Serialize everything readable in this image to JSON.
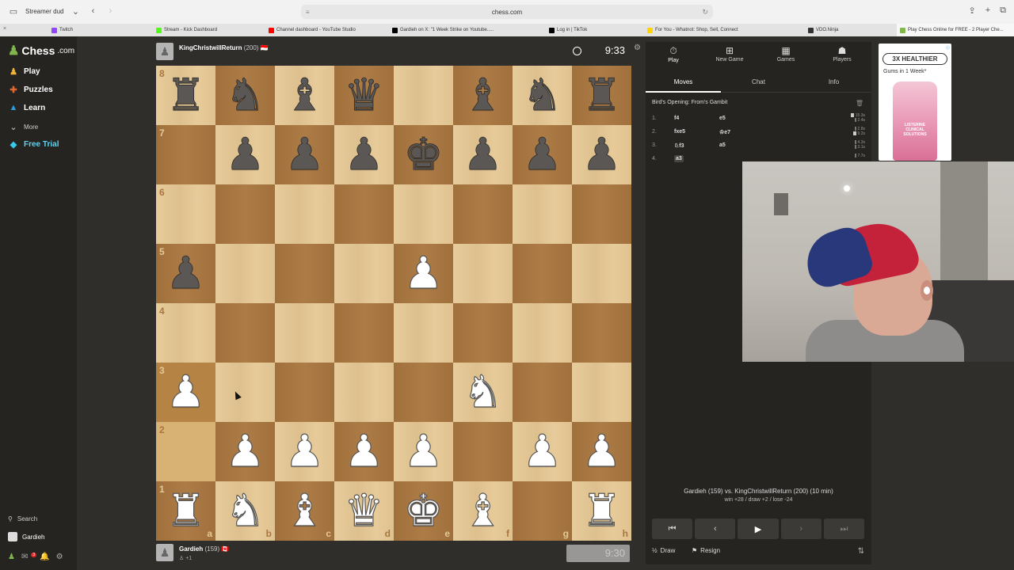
{
  "browser": {
    "profile": "Streamer dud",
    "url": "chess.com",
    "tabs": [
      {
        "label": "Twitch",
        "color": "#9146ff"
      },
      {
        "label": "Stream - Kick Dashboard",
        "color": "#53fc18"
      },
      {
        "label": "Channel dashboard - YouTube Studio",
        "color": "#ff0000"
      },
      {
        "label": "Gardieh on X: \"1 Week Strike on Youtube.....",
        "color": "#000000"
      },
      {
        "label": "Log in | TikTok",
        "color": "#000000"
      },
      {
        "label": "For You - Whatnot: Shop, Sell, Connect",
        "color": "#ffd400"
      },
      {
        "label": "VDO.Ninja",
        "color": "#333333"
      },
      {
        "label": "Play Chess Online for FREE - 2 Player Che...",
        "color": "#81b64c"
      }
    ]
  },
  "sidebar": {
    "logo": "Chess",
    "logo_suffix": ".com",
    "items": [
      {
        "label": "Play",
        "icon": "play-icon",
        "glyph": "♟",
        "color": "#f0b33a"
      },
      {
        "label": "Puzzles",
        "icon": "puzzle-icon",
        "glyph": "✚",
        "color": "#e2672f"
      },
      {
        "label": "Learn",
        "icon": "learn-icon",
        "glyph": "▲",
        "color": "#2c9ce0"
      },
      {
        "label": "More",
        "icon": "chevron-down-icon",
        "glyph": "⌄",
        "color": "#cccccc"
      },
      {
        "label": "Free Trial",
        "icon": "diamond-icon",
        "glyph": "◆",
        "color": "#38c8e8"
      }
    ],
    "search_label": "Search",
    "user_label": "Gardieh",
    "notification_count": "3"
  },
  "game": {
    "top_player": {
      "name": "KingChristwillReturn",
      "rating": "(200)",
      "flag": "🇮🇩",
      "clock": "9:33"
    },
    "bottom_player": {
      "name": "Gardieh",
      "rating": "(159)",
      "flag": "🇨🇦",
      "captured": "♙ +1",
      "clock": "9:30"
    },
    "board": [
      [
        "bR",
        "bN",
        "bB",
        "bQ",
        "",
        "bB",
        "bN",
        "bR"
      ],
      [
        "",
        "bP",
        "bP",
        "bP",
        "bK",
        "bP",
        "bP",
        "bP"
      ],
      [
        "",
        "",
        "",
        "",
        "",
        "",
        "",
        ""
      ],
      [
        "bP",
        "",
        "",
        "",
        "wP",
        "",
        "",
        ""
      ],
      [
        "",
        "",
        "",
        "",
        "",
        "",
        "",
        ""
      ],
      [
        "wP",
        "",
        "",
        "",
        "",
        "wN",
        "",
        ""
      ],
      [
        "",
        "wP",
        "wP",
        "wP",
        "wP",
        "",
        "wP",
        "wP"
      ],
      [
        "wR",
        "wN",
        "wB",
        "wQ",
        "wK",
        "wB",
        "",
        "wR"
      ]
    ],
    "ranks": [
      "8",
      "7",
      "6",
      "5",
      "4",
      "3",
      "2",
      "1"
    ],
    "files": [
      "a",
      "b",
      "c",
      "d",
      "e",
      "f",
      "g",
      "h"
    ]
  },
  "panel": {
    "nav": [
      {
        "label": "Play",
        "icon": "stopwatch-icon",
        "glyph": "⏱"
      },
      {
        "label": "New Game",
        "icon": "plus-square-icon",
        "glyph": "⊞"
      },
      {
        "label": "Games",
        "icon": "grid-icon",
        "glyph": "▦"
      },
      {
        "label": "Players",
        "icon": "players-icon",
        "glyph": "👥"
      }
    ],
    "tabs": [
      "Moves",
      "Chat",
      "Info"
    ],
    "opening": "Bird's Opening: From's Gambit",
    "moves": [
      {
        "num": "1.",
        "white": "f4",
        "black": "e5",
        "time_w": "15.3s",
        "time_b": "2.4s"
      },
      {
        "num": "2.",
        "white": "fxe5",
        "black": "♔e7",
        "time_w": "2.8s",
        "time_b": "9.2s"
      },
      {
        "num": "3.",
        "white": "♘f3",
        "black": "a5",
        "time_w": "4.3s",
        "time_b": "3.1s"
      },
      {
        "num": "4.",
        "white": "a3",
        "black": "",
        "time_w": "7.7s",
        "time_b": ""
      }
    ],
    "game_summary": "Gardieh (159) vs. KingChristwillReturn (200) (10 min)",
    "game_stakes": "win +28 / draw +2 / lose -24",
    "draw_label": "Draw",
    "resign_label": "Resign"
  },
  "ad": {
    "headline": "3X HEALTHIER",
    "subline": "Gums in 1 Week*",
    "brand": "LISTERINE CLINICAL SOLUTIONS"
  }
}
